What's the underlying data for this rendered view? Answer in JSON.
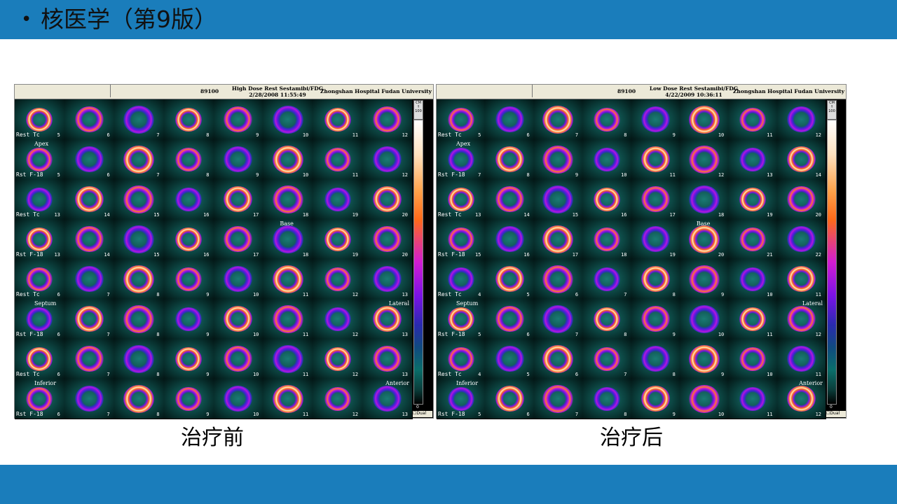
{
  "slide": {
    "title": "核医学（第9版）",
    "colors": {
      "band": "#1a7dbb",
      "background": "#ffffff"
    }
  },
  "panels": [
    {
      "patient_id": "89100",
      "study_line1": "High Dose Rest Sestamibi/FDG",
      "study_line2": "2/28/2008   11:55:49",
      "hospital": "Zhongshan Hospital Fudan University",
      "colorbar_top": "CM",
      "colorbar_max": "100",
      "colorbar_min": "0",
      "dual_label": "Dual",
      "caption": "治疗前",
      "rows": [
        {
          "label": "Rest Tc",
          "dir": "",
          "numbers": [
            "5",
            "6",
            "7",
            "8",
            "9",
            "10",
            "11",
            "12"
          ]
        },
        {
          "label": "Rst F-18",
          "dir": "Apex",
          "numbers": [
            "5",
            "6",
            "7",
            "8",
            "9",
            "10",
            "11",
            "12"
          ]
        },
        {
          "label": "Rest Tc",
          "dir": "",
          "numbers": [
            "13",
            "14",
            "15",
            "16",
            "17",
            "18",
            "19",
            "20"
          ]
        },
        {
          "label": "Rst F-18",
          "dir": "Base",
          "numbers": [
            "13",
            "14",
            "15",
            "16",
            "17",
            "18",
            "19",
            "20"
          ]
        },
        {
          "label": "Rest Tc",
          "dir": "",
          "numbers": [
            "6",
            "7",
            "8",
            "9",
            "10",
            "11",
            "12",
            "13"
          ]
        },
        {
          "label": "Rst F-18",
          "dir": "Septum",
          "dir2": "Lateral",
          "numbers": [
            "6",
            "7",
            "8",
            "9",
            "10",
            "11",
            "12",
            "13"
          ]
        },
        {
          "label": "Rest Tc",
          "dir": "",
          "numbers": [
            "6",
            "7",
            "8",
            "9",
            "10",
            "11",
            "12",
            "13"
          ]
        },
        {
          "label": "Rst F-18",
          "dir": "Inferior",
          "dir2": "Anterior",
          "numbers": [
            "6",
            "7",
            "8",
            "9",
            "10",
            "11",
            "12",
            "13"
          ]
        }
      ]
    },
    {
      "patient_id": "89100",
      "study_line1": "Low Dose Rest Sestamibi/FDG",
      "study_line2": "4/22/2009   10:36:11",
      "hospital": "Zhongshan Hospital Fudan University",
      "colorbar_top": "CM",
      "colorbar_max": "100",
      "colorbar_min": "0",
      "dual_label": "Dual",
      "caption": "治疗后",
      "rows": [
        {
          "label": "Rest Tc",
          "dir": "",
          "numbers": [
            "5",
            "6",
            "7",
            "8",
            "9",
            "10",
            "11",
            "12"
          ]
        },
        {
          "label": "Rst F-18",
          "dir": "Apex",
          "numbers": [
            "7",
            "8",
            "9",
            "10",
            "11",
            "12",
            "13",
            "14"
          ]
        },
        {
          "label": "Rest Tc",
          "dir": "",
          "numbers": [
            "13",
            "14",
            "15",
            "16",
            "17",
            "18",
            "19",
            "20"
          ]
        },
        {
          "label": "Rst F-18",
          "dir": "Base",
          "numbers": [
            "15",
            "16",
            "17",
            "18",
            "19",
            "20",
            "21",
            "22"
          ]
        },
        {
          "label": "Rest Tc",
          "dir": "",
          "numbers": [
            "4",
            "5",
            "6",
            "7",
            "8",
            "9",
            "10",
            "11"
          ]
        },
        {
          "label": "Rst F-18",
          "dir": "Septum",
          "dir2": "Lateral",
          "numbers": [
            "5",
            "6",
            "7",
            "8",
            "9",
            "10",
            "11",
            "12"
          ]
        },
        {
          "label": "Rest Tc",
          "dir": "",
          "numbers": [
            "4",
            "5",
            "6",
            "7",
            "8",
            "9",
            "10",
            "11"
          ]
        },
        {
          "label": "Rst F-18",
          "dir": "Inferior",
          "dir2": "Anterior",
          "numbers": [
            "5",
            "6",
            "7",
            "8",
            "9",
            "10",
            "11",
            "12"
          ]
        }
      ]
    }
  ]
}
